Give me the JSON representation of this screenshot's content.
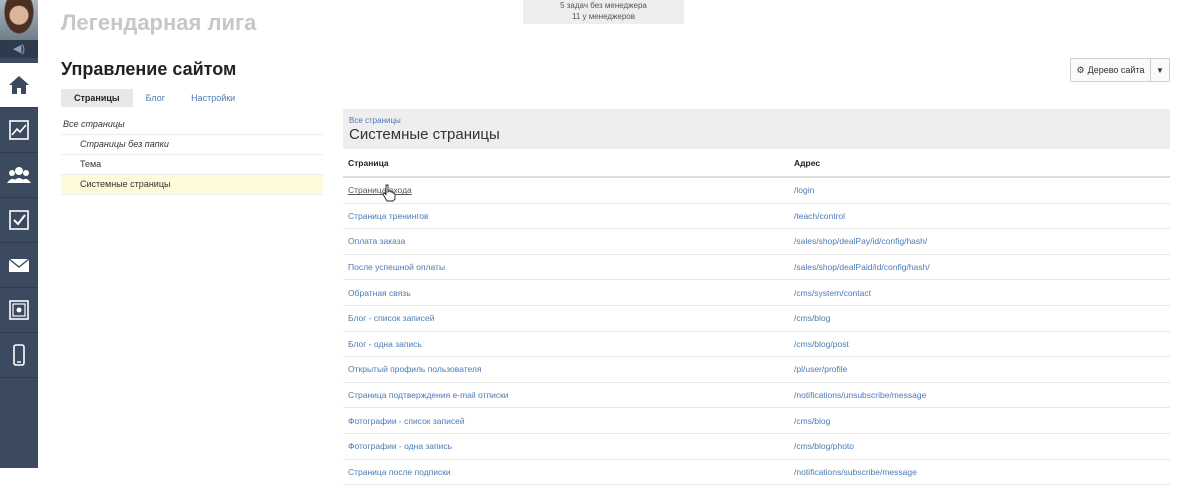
{
  "topbox": {
    "line1": "5 задач без менеджера",
    "line2": "11 у менеджеров"
  },
  "brand": "Легендарная лига",
  "page_title": "Управление сайтом",
  "tree_button": {
    "label": "Дерево сайта"
  },
  "tabs": [
    {
      "label": "Страницы",
      "active": true
    },
    {
      "label": "Блог",
      "active": false
    },
    {
      "label": "Настройки",
      "active": false
    }
  ],
  "tree": [
    {
      "label": "Все страницы",
      "level": 0
    },
    {
      "label": "Страницы без папки",
      "level": 1
    },
    {
      "label": "Тема",
      "level": 1
    },
    {
      "label": "Системные страницы",
      "level": 1,
      "selected": true
    }
  ],
  "panel": {
    "breadcrumb": "Все страницы",
    "title": "Системные страницы",
    "columns": [
      "Страница",
      "Адрес"
    ],
    "rows": [
      {
        "page": "Страница входа",
        "address": "/login"
      },
      {
        "page": "Страница тренингов",
        "address": "/teach/control"
      },
      {
        "page": "Оплата заказа",
        "address": "/sales/shop/dealPay/id/config/hash/"
      },
      {
        "page": "После успешной оплаты",
        "address": "/sales/shop/dealPaid/id/config/hash/"
      },
      {
        "page": "Обратная связь",
        "address": "/cms/system/contact"
      },
      {
        "page": "Блог - список записей",
        "address": "/cms/blog"
      },
      {
        "page": "Блог - одна запись",
        "address": "/cms/blog/post"
      },
      {
        "page": "Открытый профиль пользователя",
        "address": "/pl/user/profile"
      },
      {
        "page": "Страница подтверждения e-mail отписки",
        "address": "/notifications/unsubscribe/message"
      },
      {
        "page": "Фотографии - список записей",
        "address": "/cms/blog"
      },
      {
        "page": "Фотографии - одна запись",
        "address": "/cms/blog/photo"
      },
      {
        "page": "Страница после подписки",
        "address": "/notifications/subscribe/message"
      }
    ]
  },
  "sidebar_icons": [
    "home-icon",
    "chart-icon",
    "users-icon",
    "checkbox-icon",
    "mail-icon",
    "safe-icon",
    "phone-icon"
  ],
  "colors": {
    "sidebar": "#3b4a5e",
    "link": "#4a7bb5",
    "selected_row": "#fdfbd9"
  }
}
